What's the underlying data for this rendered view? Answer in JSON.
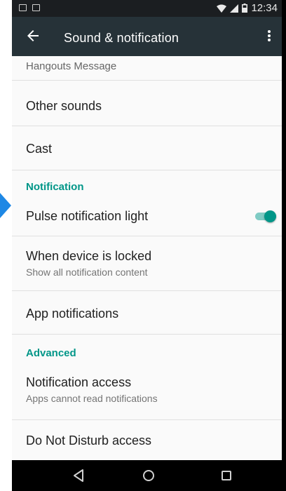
{
  "status_bar": {
    "time": "12:34",
    "left_icons": [
      "image-notification-icon",
      "email-notification-icon"
    ],
    "right_icons": [
      "wifi-icon",
      "cell-signal-icon",
      "battery-icon"
    ]
  },
  "toolbar": {
    "title": "Sound & notification",
    "back_icon": "arrow-left-icon",
    "more_icon": "more-vert-icon",
    "background": "#263238"
  },
  "items": {
    "hangouts_message": {
      "label": "Hangouts Message"
    },
    "other_sounds": {
      "label": "Other sounds"
    },
    "cast": {
      "label": "Cast"
    },
    "notification_header": "Notification",
    "pulse_light": {
      "label": "Pulse notification light",
      "toggle_on": true
    },
    "device_locked": {
      "label": "When device is locked",
      "summary": "Show all notification content"
    },
    "app_notifications": {
      "label": "App notifications"
    },
    "advanced_header": "Advanced",
    "notification_access": {
      "label": "Notification access",
      "summary": "Apps cannot read notifications"
    },
    "dnd_access": {
      "label": "Do Not Disturb access"
    }
  },
  "nav_bar": [
    "back-triangle-icon",
    "home-circle-icon",
    "recents-square-icon"
  ],
  "colors": {
    "accent": "#009688",
    "pointer": "#1e88e5"
  }
}
